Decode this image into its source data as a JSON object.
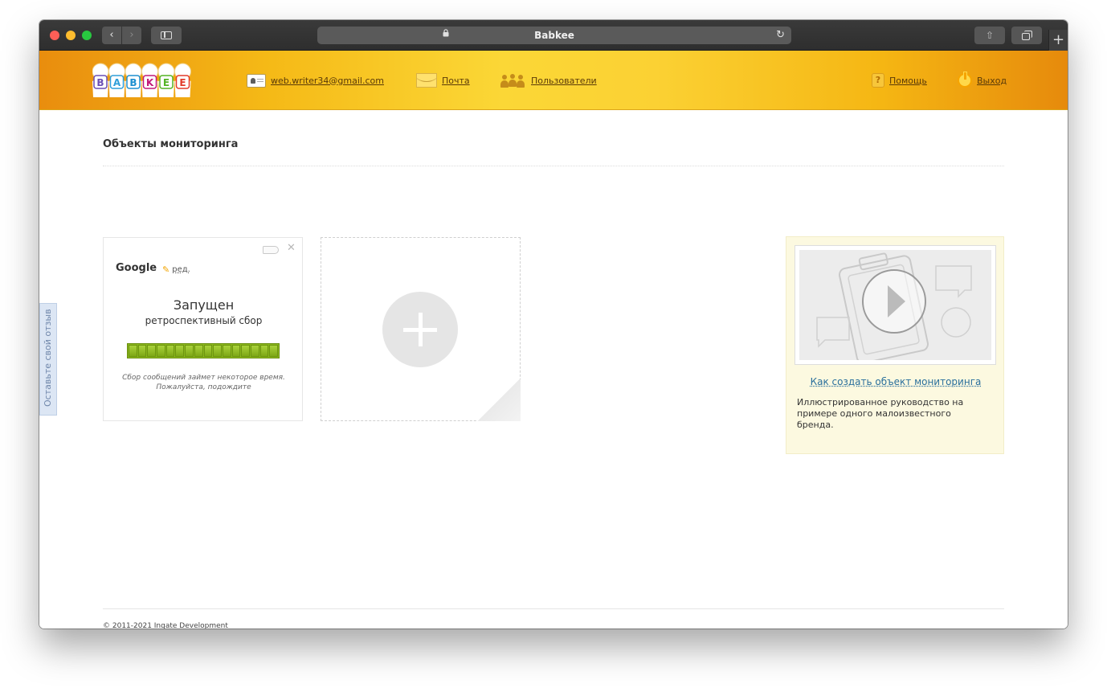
{
  "browser": {
    "title": "Babkee",
    "back_icon": "‹",
    "forward_icon": "›",
    "lock_icon": "lock",
    "reload_icon": "reload",
    "new_tab_icon": "+"
  },
  "header": {
    "logo_letters": [
      "B",
      "A",
      "B",
      "K",
      "E",
      "E"
    ],
    "logo_colors": [
      "#6b4fb5",
      "#2e9ed9",
      "#1d8fd0",
      "#c2197a",
      "#53b324",
      "#e23a2a"
    ],
    "email": "web.writer34@gmail.com",
    "mail_label": "Почта",
    "users_label": "Пользователи",
    "help_label": "Помощь",
    "help_glyph": "?",
    "logout_label": "Выход"
  },
  "feedback": {
    "label": "Оставьте свой отзыв"
  },
  "page": {
    "title": "Объекты мониторинга"
  },
  "monitor_card": {
    "name": "Google",
    "edit_label": "ред.",
    "status": "Запущен",
    "substatus": "ретроспективный сбор",
    "progress_segments": 16,
    "note": "Сбор сообщений займет некоторое время. Пожалуйста, подождите",
    "close_glyph": "✕"
  },
  "guide": {
    "link": "Как создать объект мониторинга",
    "description": "Иллюстрированное руководство на примере одного малоизвестного бренда."
  },
  "footer": {
    "copyright": "© 2011-2021 Ingate Development"
  }
}
